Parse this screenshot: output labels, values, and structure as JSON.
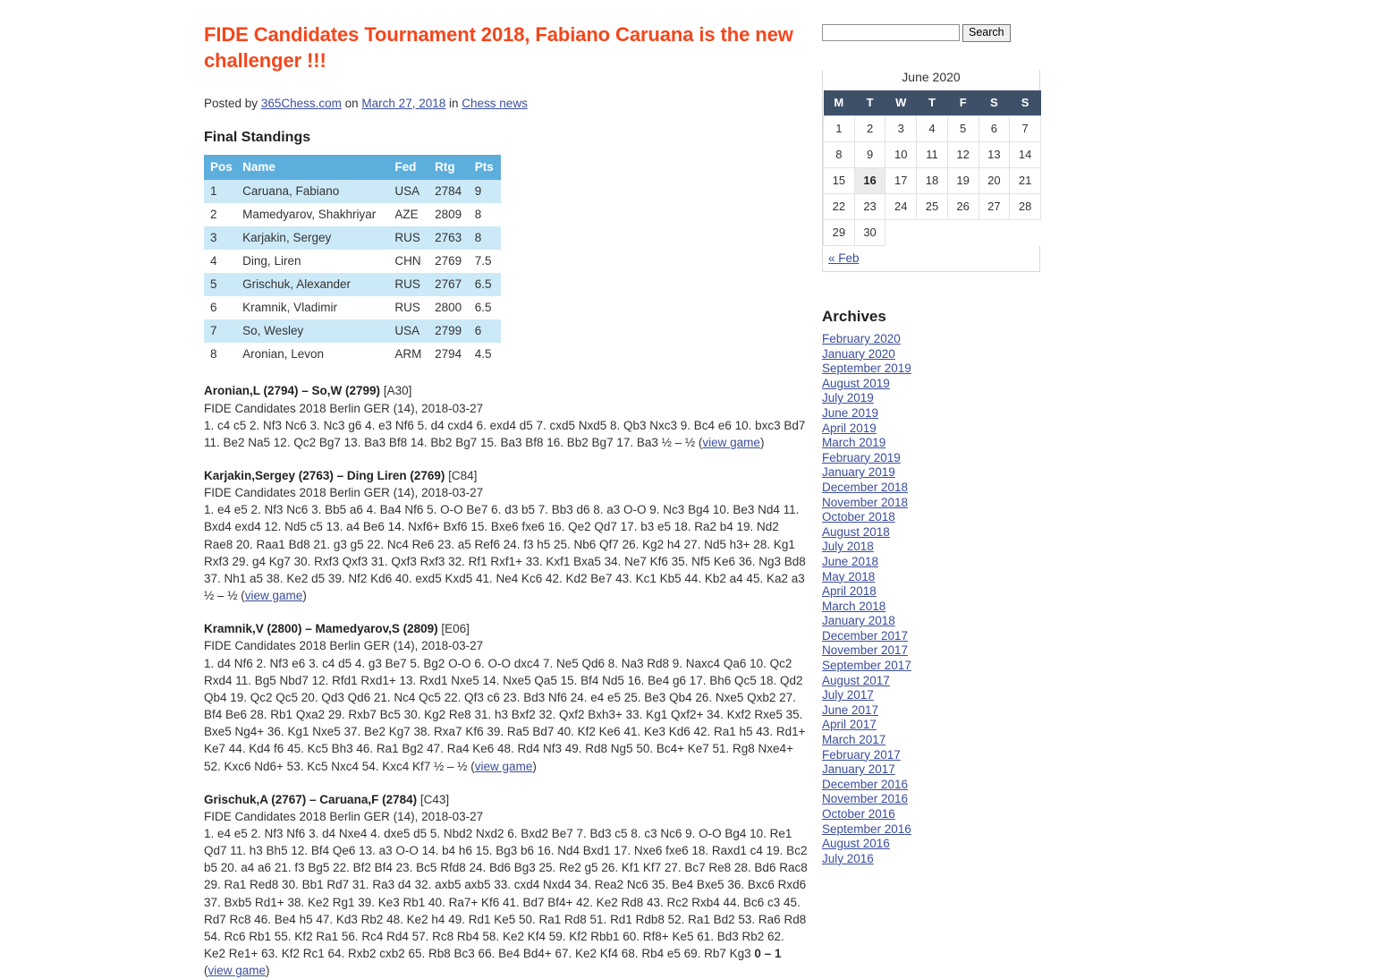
{
  "post": {
    "title": "FIDE Candidates Tournament 2018, Fabiano Caruana is the new challenger !!!",
    "meta_posted_by": "Posted by",
    "meta_author": "365Chess.com",
    "meta_on": "on",
    "meta_date": "March 27, 2018",
    "meta_in": "in",
    "meta_category": "Chess news",
    "section_heading": "Final Standings",
    "title_color": "#F4461C",
    "link_color": "#3B4E9B"
  },
  "standings": {
    "columns": [
      "Pos",
      "Name",
      "Fed",
      "Rtg",
      "Pts"
    ],
    "header_bg": "#5CAEDD",
    "row_alt_bg": "#CCE9F8",
    "rows": [
      {
        "pos": "1",
        "name": "Caruana, Fabiano",
        "fed": "USA",
        "rtg": "2784",
        "pts": "9"
      },
      {
        "pos": "2",
        "name": "Mamedyarov, Shakhriyar",
        "fed": "AZE",
        "rtg": "2809",
        "pts": "8"
      },
      {
        "pos": "3",
        "name": "Karjakin, Sergey",
        "fed": "RUS",
        "rtg": "2763",
        "pts": "8"
      },
      {
        "pos": "4",
        "name": "Ding, Liren",
        "fed": "CHN",
        "rtg": "2769",
        "pts": "7.5"
      },
      {
        "pos": "5",
        "name": "Grischuk, Alexander",
        "fed": "RUS",
        "rtg": "2767",
        "pts": "6.5"
      },
      {
        "pos": "6",
        "name": "Kramnik, Vladimir",
        "fed": "RUS",
        "rtg": "2800",
        "pts": "6.5"
      },
      {
        "pos": "7",
        "name": "So, Wesley",
        "fed": "USA",
        "rtg": "2799",
        "pts": "6"
      },
      {
        "pos": "8",
        "name": "Aronian, Levon",
        "fed": "ARM",
        "rtg": "2794",
        "pts": "4.5"
      }
    ]
  },
  "games": [
    {
      "header": "Aronian,L (2794) – So,W (2799)",
      "eco": "[A30]",
      "event": "FIDE Candidates 2018 Berlin GER (14), 2018-03-27",
      "moves": "1. c4 c5 2. Nf3 Nc6 3. Nc3 g6 4. e3 Nf6 5. d4 cxd4 6. exd4 d5 7. cxd5 Nxd5 8. Qb3 Nxc3 9. Bc4 e6 10. bxc3 Bd7 11. Be2 Na5 12. Qc2 Bg7 13. Ba3 Bf8 14. Bb2 Bg7 15. Ba3 Bf8 16. Bb2 Bg7 17. Ba3",
      "result": "½ – ½",
      "result_bold": false,
      "link": "view game"
    },
    {
      "header": "Karjakin,Sergey (2763) – Ding Liren (2769)",
      "eco": "[C84]",
      "event": "FIDE Candidates 2018 Berlin GER (14), 2018-03-27",
      "moves": "1. e4 e5 2. Nf3 Nc6 3. Bb5 a6 4. Ba4 Nf6 5. O-O Be7 6. d3 b5 7. Bb3 d6 8. a3 O-O 9. Nc3 Bg4 10. Be3 Nd4 11. Bxd4 exd4 12. Nd5 c5 13. a4 Be6 14. Nxf6+ Bxf6 15. Bxe6 fxe6 16. Qe2 Qd7 17. b3 e5 18. Ra2 b4 19. Nd2 Rae8 20. Raa1 Bd8 21. g3 g5 22. Nc4 Re6 23. a5 Ref6 24. f3 h5 25. Nb6 Qf7 26. Kg2 h4 27. Nd5 h3+ 28. Kg1 Rxf3 29. g4 Kg7 30. Rxf3 Qxf3 31. Qxf3 Rxf3 32. Rf1 Rxf1+ 33. Kxf1 Bxa5 34. Ne7 Kf6 35. Nf5 Ke6 36. Ng3 Bd8 37. Nh1 a5 38. Ke2 d5 39. Nf2 Kd6 40. exd5 Kxd5 41. Ne4 Kc6 42. Kd2 Be7 43. Kc1 Kb5 44. Kb2 a4 45. Ka2 a3",
      "result": "½ – ½",
      "result_bold": false,
      "link": "view game"
    },
    {
      "header": "Kramnik,V (2800) – Mamedyarov,S (2809)",
      "eco": "[E06]",
      "event": "FIDE Candidates 2018 Berlin GER (14), 2018-03-27",
      "moves": "1. d4 Nf6 2. Nf3 e6 3. c4 d5 4. g3 Be7 5. Bg2 O-O 6. O-O dxc4 7. Ne5 Qd6 8. Na3 Rd8 9. Naxc4 Qa6 10. Qc2 Rxd4 11. Bg5 Nbd7 12. Rfd1 Rxd1+ 13. Rxd1 Nxe5 14. Nxe5 Qa5 15. Bf4 Nd5 16. Be4 g6 17. Bh6 Qc5 18. Qd2 Qb4 19. Qc2 Qc5 20. Qd3 Qd6 21. Nc4 Qc5 22. Qf3 c6 23. Bd3 Nf6 24. e4 e5 25. Be3 Qb4 26. Nxe5 Qxb2 27. Bf4 Be6 28. Rb1 Qxa2 29. Rxb7 Bc5 30. Kg2 Re8 31. h3 Bxf2 32. Qxf2 Bxh3+ 33. Kg1 Qxf2+ 34. Kxf2 Rxe5 35. Bxe5 Ng4+ 36. Kg1 Nxe5 37. Be2 Kg7 38. Rxa7 Kf6 39. Ra5 Bd7 40. Kf2 Ke6 41. Ke3 Kd6 42. Ra1 h5 43. Rd1+ Ke7 44. Kd4 f6 45. Kc5 Bh3 46. Ra1 Bg2 47. Ra4 Ke6 48. Rd4 Nf3 49. Rd8 Ng5 50. Bc4+ Ke7 51. Rg8 Nxe4+ 52. Kxc6 Nd6+ 53. Kc5 Nxc4 54. Kxc4 Kf7",
      "result": "½ – ½",
      "result_bold": false,
      "link": "view game"
    },
    {
      "header": "Grischuk,A (2767) – Caruana,F (2784)",
      "eco": "[C43]",
      "event": "FIDE Candidates 2018 Berlin GER (14), 2018-03-27",
      "moves": "1. e4 e5 2. Nf3 Nf6 3. d4 Nxe4 4. dxe5 d5 5. Nbd2 Nxd2 6. Bxd2 Be7 7. Bd3 c5 8. c3 Nc6 9. O-O Bg4 10. Re1 Qd7 11. h3 Bh5 12. Bf4 Qe6 13. a3 O-O 14. b4 h6 15. Bg3 b6 16. Nd4 Bxd1 17. Nxe6 fxe6 18. Raxd1 c4 19. Bc2 b5 20. a4 a6 21. f3 Bg5 22. Bf2 Bf4 23. Bc5 Rfd8 24. Bd6 Bg3 25. Re2 g5 26. Kf1 Kf7 27. Bc7 Re8 28. Bd6 Rac8 29. Ra1 Red8 30. Bb1 Rd7 31. Ra3 d4 32. axb5 axb5 33. cxd4 Nxd4 34. Rea2 Nc6 35. Be4 Bxe5 36. Bxc6 Rxd6 37. Bxb5 Rd1+ 38. Ke2 Rg1 39. Ke3 Rb1 40. Ra7+ Kf6 41. Bd7 Bf4+ 42. Ke2 Rd8 43. Rc2 Rxb4 44. Bc6 c3 45. Rd7 Rc8 46. Be4 h5 47. Kd3 Rb2 48. Ke2 h4 49. Rd1 Ke5 50. Ra1 Rd8 51. Rd1 Rdb8 52. Ra1 Bd2 53. Ra6 Rd8 54. Rc6 Rb1 55. Kf2 Ra1 56. Rc4 Rd4 57. Rc8 Rb4 58. Ke2 Kf4 59. Kf2 Rbb1 60. Rf8+ Ke5 61. Bd3 Rb2 62. Ke2 Re1+ 63. Kf2 Rc1 64. Rxb2 cxb2 65. Rb8 Bc3 66. Be4 Bd4+ 67. Ke2 Kf4 68. Rb4 e5 69. Rb7 Kg3",
      "result": "0 – 1",
      "result_bold": true,
      "link": "view game"
    }
  ],
  "sidebar": {
    "search": {
      "value": "",
      "placeholder": "",
      "button_label": "Search"
    },
    "calendar": {
      "caption": "June 2020",
      "header_bg": "#3E5068",
      "weekdays": [
        "M",
        "T",
        "W",
        "T",
        "F",
        "S",
        "S"
      ],
      "weeks": [
        [
          "1",
          "2",
          "3",
          "4",
          "5",
          "6",
          "7"
        ],
        [
          "8",
          "9",
          "10",
          "11",
          "12",
          "13",
          "14"
        ],
        [
          "15",
          "16",
          "17",
          "18",
          "19",
          "20",
          "21"
        ],
        [
          "22",
          "23",
          "24",
          "25",
          "26",
          "27",
          "28"
        ],
        [
          "29",
          "30",
          "",
          "",
          "",
          "",
          ""
        ]
      ],
      "today": "16",
      "prev_link": "« Feb"
    },
    "archives": {
      "heading": "Archives",
      "items": [
        "February 2020",
        "January 2020",
        "September 2019",
        "August 2019",
        "July 2019",
        "June 2019",
        "April 2019",
        "March 2019",
        "February 2019",
        "January 2019",
        "December 2018",
        "November 2018",
        "October 2018",
        "August 2018",
        "July 2018",
        "June 2018",
        "May 2018",
        "April 2018",
        "March 2018",
        "January 2018",
        "December 2017",
        "November 2017",
        "September 2017",
        "August 2017",
        "July 2017",
        "June 2017",
        "April 2017",
        "March 2017",
        "February 2017",
        "January 2017",
        "December 2016",
        "November 2016",
        "October 2016",
        "September 2016",
        "August 2016",
        "July 2016"
      ]
    }
  }
}
